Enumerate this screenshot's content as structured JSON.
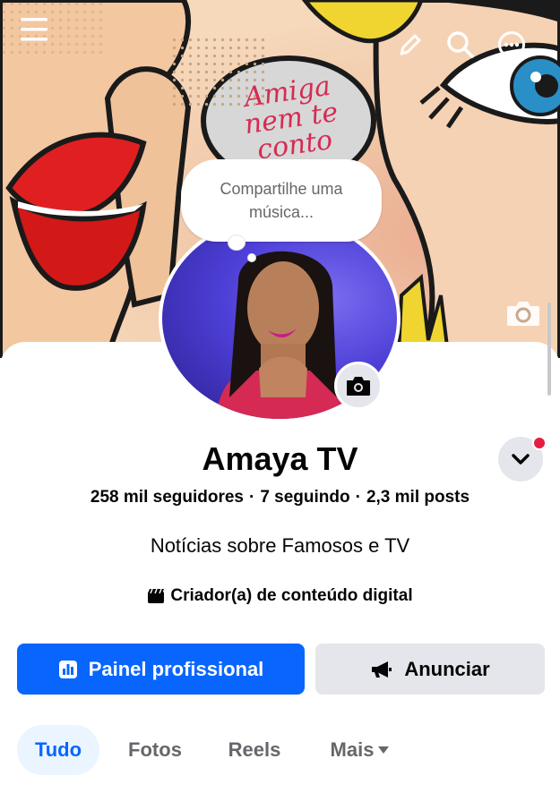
{
  "cover": {
    "speech_text_line1": "Amiga",
    "speech_text_line2": "nem te",
    "speech_text_line3": "conto"
  },
  "profile": {
    "name": "Amaya TV",
    "stats": {
      "followers": "258 mil seguidores",
      "following": "7 seguindo",
      "posts": "2,3 mil posts",
      "separator": "·"
    },
    "bio": "Notícias sobre Famosos e TV",
    "category": "Criador(a) de conteúdo digital",
    "note_prompt": "Compartilhe uma música..."
  },
  "buttons": {
    "dashboard": "Painel profissional",
    "advertise": "Anunciar"
  },
  "tabs": [
    {
      "label": "Tudo"
    },
    {
      "label": "Fotos"
    },
    {
      "label": "Reels"
    },
    {
      "label": "Mais"
    }
  ],
  "colors": {
    "primary": "#0866ff",
    "secondary_bg": "#e4e6eb",
    "notification": "#e41e3f"
  },
  "icons": [
    "menu-icon",
    "edit-icon",
    "search-icon",
    "more-icon",
    "camera-icon",
    "chevron-down-icon",
    "dashboard-icon",
    "megaphone-icon",
    "category-icon",
    "caret-down-icon"
  ]
}
